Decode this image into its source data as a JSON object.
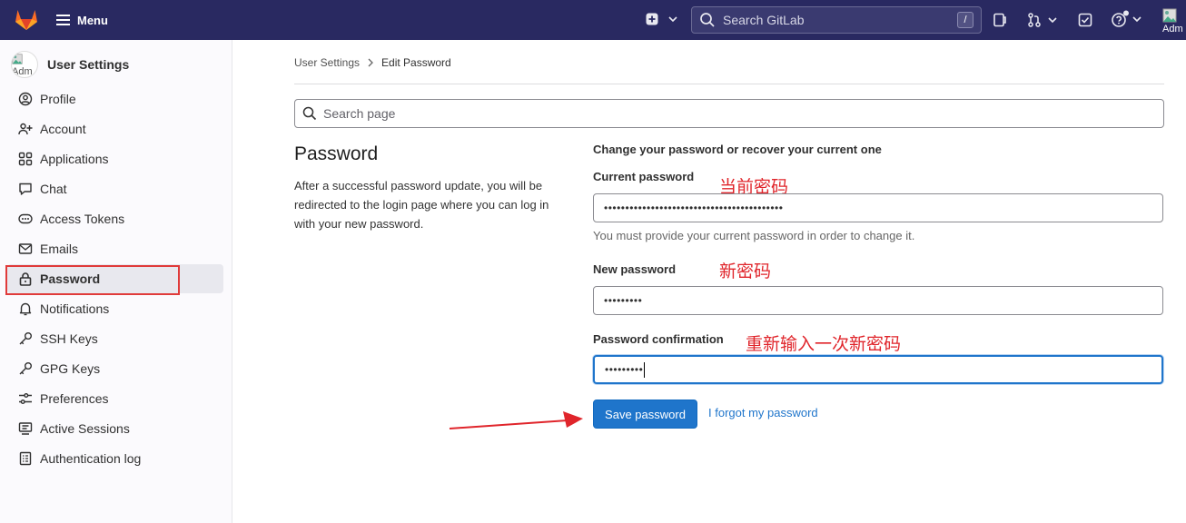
{
  "topbar": {
    "menu_label": "Menu",
    "search_placeholder": "Search GitLab",
    "search_shortcut": "/",
    "avatar_alt": "Adm"
  },
  "sidebar": {
    "avatar_alt": "Adm",
    "title": "User Settings",
    "items": [
      {
        "label": "Profile",
        "icon": "profile-icon"
      },
      {
        "label": "Account",
        "icon": "account-icon"
      },
      {
        "label": "Applications",
        "icon": "applications-icon"
      },
      {
        "label": "Chat",
        "icon": "chat-icon"
      },
      {
        "label": "Access Tokens",
        "icon": "token-icon"
      },
      {
        "label": "Emails",
        "icon": "mail-icon"
      },
      {
        "label": "Password",
        "icon": "lock-icon",
        "active": true
      },
      {
        "label": "Notifications",
        "icon": "bell-icon"
      },
      {
        "label": "SSH Keys",
        "icon": "key-icon"
      },
      {
        "label": "GPG Keys",
        "icon": "key-icon"
      },
      {
        "label": "Preferences",
        "icon": "preferences-icon"
      },
      {
        "label": "Active Sessions",
        "icon": "sessions-icon"
      },
      {
        "label": "Authentication log",
        "icon": "log-icon"
      }
    ]
  },
  "breadcrumb": {
    "parent": "User Settings",
    "current": "Edit Password"
  },
  "page_search": {
    "placeholder": "Search page"
  },
  "password_section": {
    "title": "Password",
    "description": "After a successful password update, you will be redirected to the login page where you can log in with your new password."
  },
  "form": {
    "intro": "Change your password or recover your current one",
    "current_label": "Current password",
    "current_value": "••••••••••••••••••••••••••••••••••••••••••",
    "current_help": "You must provide your current password in order to change it.",
    "new_label": "New password",
    "new_value": "•••••••••",
    "confirm_label": "Password confirmation",
    "confirm_value": "•••••••••",
    "save_label": "Save password",
    "forgot_label": "I forgot my password"
  },
  "annotations": {
    "current": "当前密码",
    "new": "新密码",
    "confirm": "重新输入一次新密码"
  },
  "colors": {
    "topbar": "#292961",
    "primary": "#1f75cb",
    "annotation": "#e0252b"
  }
}
